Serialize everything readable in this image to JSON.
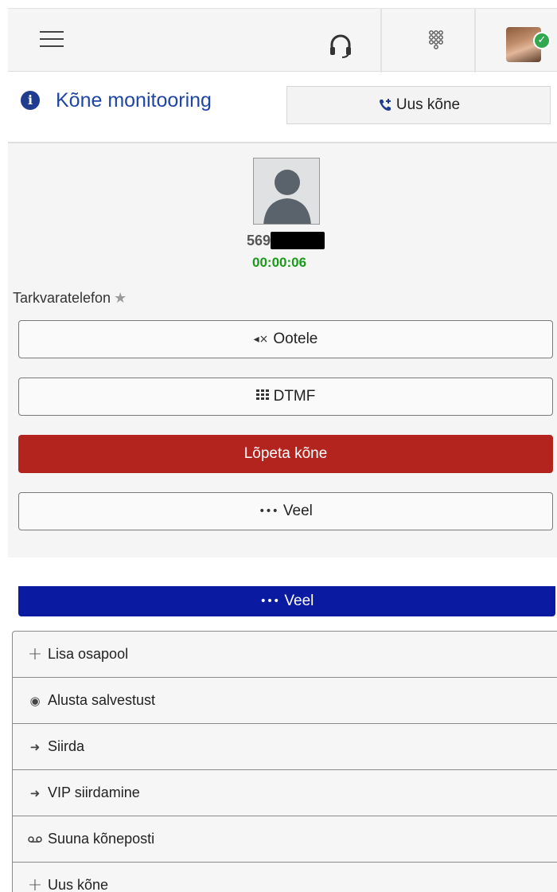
{
  "header": {
    "menu_icon": "hamburger-icon",
    "headset_icon": "headset-icon",
    "dialpad_icon": "dialpad-icon",
    "status_icon": "check-icon",
    "status_color": "#2fa84f"
  },
  "title": {
    "text": "Kõne monitooring",
    "info_icon": "info-icon",
    "new_call_label": "Uus kõne",
    "new_call_icon": "phone-plus-icon"
  },
  "caller": {
    "number": "569",
    "timer": "00:00:06",
    "phone_type": "Tarkvaratelefon",
    "favorite_icon": "star-icon"
  },
  "actions": {
    "hold": {
      "label": "Ootele",
      "icon": "mute-icon"
    },
    "dtmf": {
      "label": "DTMF",
      "icon": "keypad-icon"
    },
    "end": {
      "label": "Lõpeta kõne",
      "color": "#b3241f"
    },
    "more": {
      "label": "Veel",
      "icon": "ellipsis-icon"
    }
  },
  "more_menu": {
    "label": "Veel",
    "active_color": "#0a1aa1",
    "items": [
      {
        "label": "Lisa osapool",
        "icon": "plus-icon"
      },
      {
        "label": "Alusta salvestust",
        "icon": "record-icon"
      },
      {
        "label": "Siirda",
        "icon": "arrow-right-icon"
      },
      {
        "label": "VIP siirdamine",
        "icon": "arrow-right-icon"
      },
      {
        "label": "Suuna kõneposti",
        "icon": "voicemail-icon"
      },
      {
        "label": "Uus kõne",
        "icon": "plus-icon"
      }
    ]
  }
}
